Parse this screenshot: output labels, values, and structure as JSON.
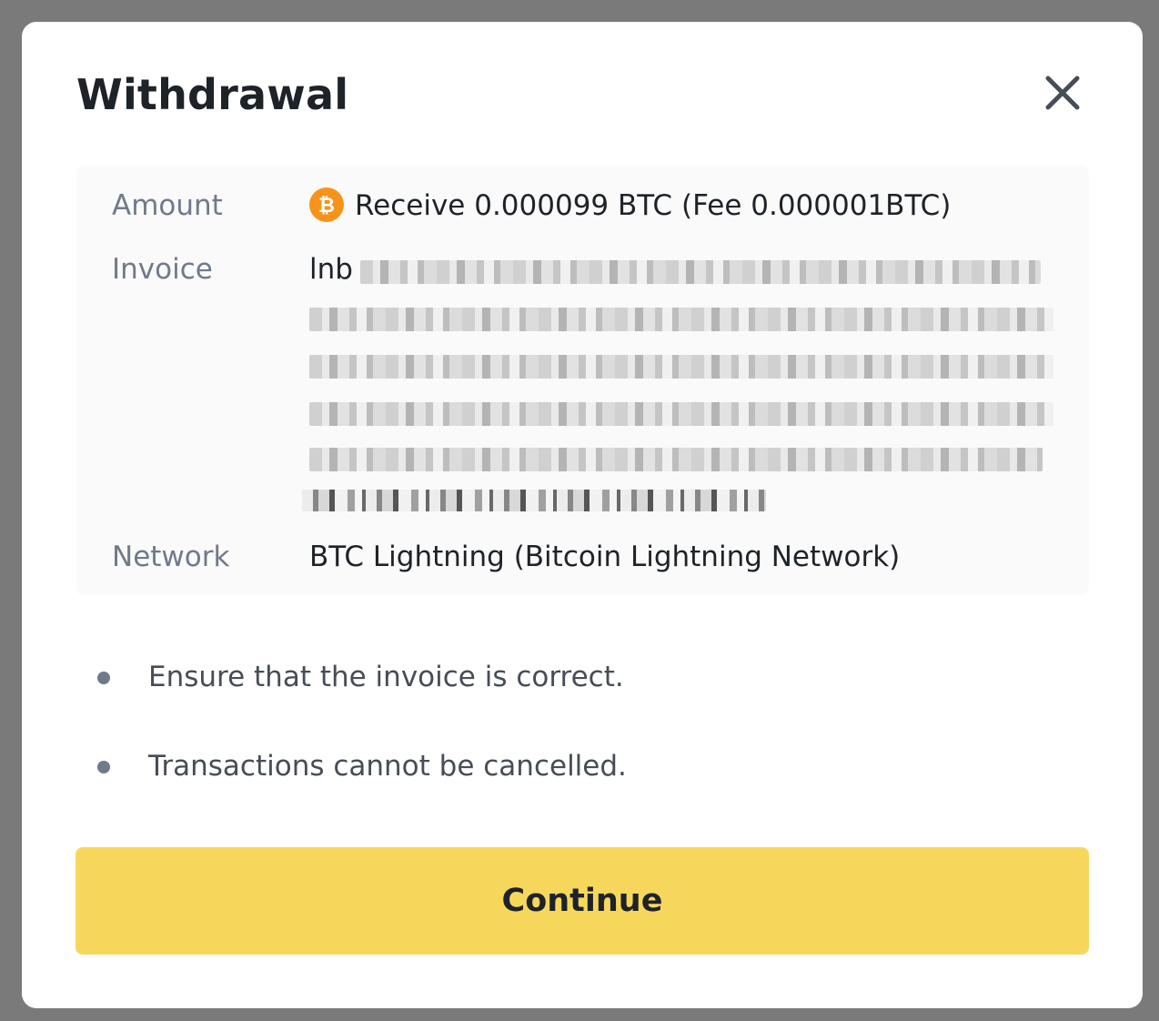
{
  "modal": {
    "title": "Withdrawal",
    "close_icon": "close-icon"
  },
  "details": {
    "amount_label": "Amount",
    "amount_value": "Receive 0.000099 BTC",
    "fee_value": "(Fee 0.000001BTC)",
    "coin_icon": "bitcoin-icon",
    "coin_color": "#f7931a",
    "invoice_label": "Invoice",
    "invoice_visible_prefix": "lnb",
    "network_label": "Network",
    "network_value": "BTC Lightning (Bitcoin Lightning Network)"
  },
  "notes": [
    {
      "text": "Ensure that the invoice is correct."
    },
    {
      "text": "Transactions cannot be cancelled."
    }
  ],
  "actions": {
    "continue_label": "Continue",
    "continue_color": "#f6d75c"
  }
}
